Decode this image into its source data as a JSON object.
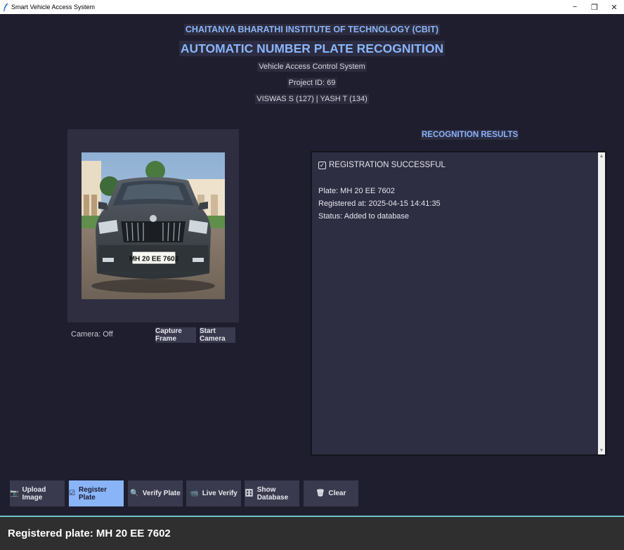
{
  "window": {
    "title": "Smart Vehicle Access System",
    "minimize_glyph": "−",
    "restore_glyph": "❐",
    "close_glyph": "✕"
  },
  "header": {
    "institute": "CHAITANYA BHARATHI INSTITUTE OF TECHNOLOGY (CBIT)",
    "title": "AUTOMATIC NUMBER PLATE RECOGNITION",
    "subtitle": "Vehicle Access Control System",
    "project_id": "Project ID: 69",
    "members": "VISWAS S (127) | YASH T (134)"
  },
  "camera": {
    "status": "Camera: Off",
    "capture_label": "Capture Frame",
    "start_label": "Start Camera",
    "plate_text": "MH 20 EE 7602"
  },
  "results": {
    "title": "RECOGNITION RESULTS",
    "heading": "REGISTRATION SUCCESSFUL",
    "plate": "Plate: MH 20 EE 7602",
    "registered_at": "Registered at: 2025-04-15 14:41:35",
    "status": "Status: Added to database"
  },
  "actions": [
    {
      "label": "Upload Image",
      "icon": "camera-icon",
      "glyph": "📷"
    },
    {
      "label": "Register Plate",
      "icon": "checkbox-icon",
      "glyph": "☑",
      "active": true
    },
    {
      "label": "Verify Plate",
      "icon": "search-icon",
      "glyph": "🔍"
    },
    {
      "label": "Live Verify",
      "icon": "video-icon",
      "glyph": "📹"
    },
    {
      "label": "Show Database",
      "icon": "database-icon",
      "glyph": "🗄"
    },
    {
      "label": "Clear",
      "icon": "trash-icon",
      "glyph": "🗑"
    }
  ],
  "statusbar": {
    "text": "Registered plate: MH 20 EE 7602"
  },
  "colors": {
    "background": "#1e1e2e",
    "accent": "#8ab4f8",
    "panel": "#2e2e42",
    "button": "#3a3a4e",
    "statusbar_border": "#6fc2c9"
  }
}
